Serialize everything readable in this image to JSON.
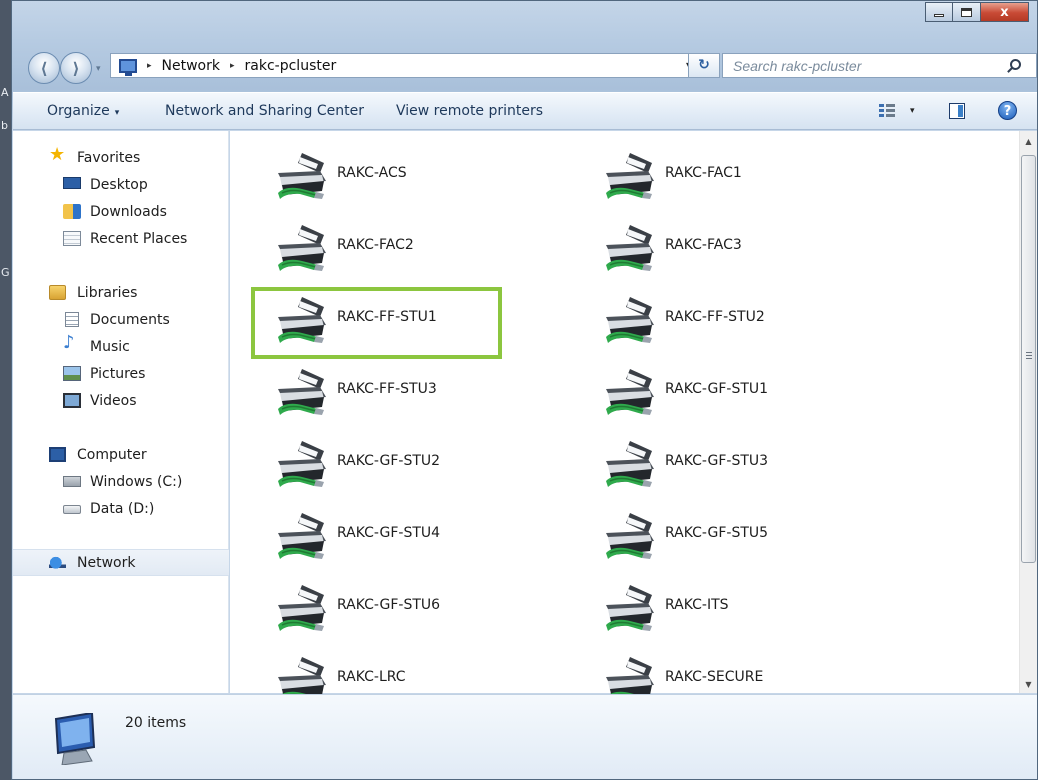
{
  "edge_letters": [
    "A",
    "b",
    "G"
  ],
  "window": {
    "minimize_glyph": "minimize-icon",
    "maximize_glyph": "maximize-icon",
    "close_glyph": "x"
  },
  "address_bar": {
    "forward_glyph": "⟩",
    "back_glyph": "⟨",
    "history_glyph": "▾",
    "crumbs": [
      "Network",
      "rakc-pcluster"
    ],
    "crumb_separator": "▸",
    "dropdown_glyph": "▾",
    "refresh_glyph": "↻",
    "search_placeholder": "Search rakc-pcluster"
  },
  "toolbar": {
    "organize": "Organize",
    "organize_arrow": "▾",
    "network_sharing": "Network and Sharing Center",
    "view_printers": "View remote printers",
    "views_arrow": "▾",
    "help": "?"
  },
  "nav": {
    "favorites": {
      "label": "Favorites",
      "items": [
        "Desktop",
        "Downloads",
        "Recent Places"
      ]
    },
    "libraries": {
      "label": "Libraries",
      "items": [
        "Documents",
        "Music",
        "Pictures",
        "Videos"
      ]
    },
    "computer": {
      "label": "Computer",
      "items": [
        "Windows (C:)",
        "Data (D:)"
      ]
    },
    "network": {
      "label": "Network"
    }
  },
  "printers": [
    "RAKC-ACS",
    "RAKC-FAC1",
    "RAKC-FAC2",
    "RAKC-FAC3",
    "RAKC-FF-STU1",
    "RAKC-FF-STU2",
    "RAKC-FF-STU3",
    "RAKC-GF-STU1",
    "RAKC-GF-STU2",
    "RAKC-GF-STU3",
    "RAKC-GF-STU4",
    "RAKC-GF-STU5",
    "RAKC-GF-STU6",
    "RAKC-ITS",
    "RAKC-LRC",
    "RAKC-SECURE"
  ],
  "highlighted_printer": "RAKC-FF-STU1",
  "highlight_color": "#8cc63f",
  "scrollbar": {
    "up_glyph": "▲",
    "down_glyph": "▼"
  },
  "details": {
    "count_text": "20 items"
  }
}
